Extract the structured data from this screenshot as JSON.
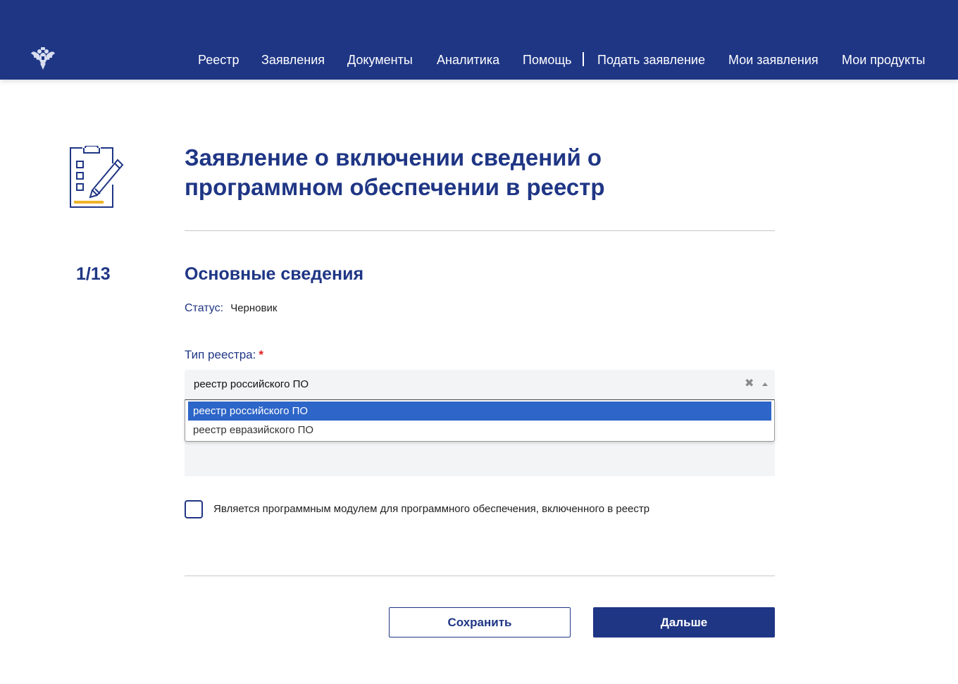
{
  "header": {
    "nav": [
      {
        "label": "Реестр"
      },
      {
        "label": "Заявления"
      },
      {
        "label": "Документы"
      },
      {
        "label": "Аналитика"
      },
      {
        "label": "Помощь"
      },
      {
        "label": "Подать заявление"
      },
      {
        "label": "Мои заявления"
      },
      {
        "label": "Мои продукты"
      }
    ],
    "emblem_icon": "russian-coat-of-arms-icon"
  },
  "page": {
    "title": "Заявление о включении сведений о программном обеспечении в реестр",
    "step": "1/13",
    "section_title": "Основные сведения",
    "status_label": "Статус:",
    "status_value": "Черновик",
    "form_icon": "clipboard-checklist-pen-icon"
  },
  "form": {
    "registry_type": {
      "label": "Тип реестра:",
      "required_mark": "*",
      "value": "реестр российского ПО",
      "clear_icon": "clear-x-icon",
      "arrow_icon": "chevron-up-icon",
      "options": [
        {
          "label": "реестр российского ПО",
          "selected": true
        },
        {
          "label": "реестр евразийского ПО",
          "selected": false
        }
      ]
    },
    "module_checkbox": {
      "label": "Является программным модулем для программного обеспечения, включенного в реестр",
      "checked": false
    }
  },
  "actions": {
    "save_label": "Сохранить",
    "next_label": "Дальше"
  },
  "colors": {
    "brand": "#1f3685",
    "selected_option": "#2d65c8",
    "required": "#e02020",
    "accent_yellow": "#f0b429"
  }
}
